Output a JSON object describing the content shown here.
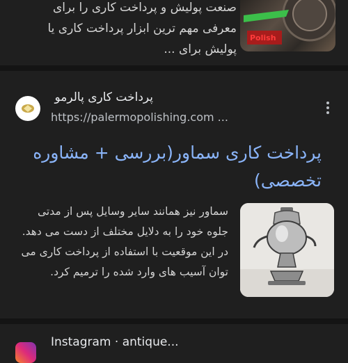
{
  "result1": {
    "snippet_lines": [
      "صنعت پولیش و پرداخت کاری را برای",
      "معرفی مهم ترین ابزار پرداخت کاری یا",
      "پولیش برای ..."
    ],
    "thumb_text": "Polish"
  },
  "result2": {
    "site_name": "پرداخت کاری پالرمو",
    "url": "https://palermopolishing.com ...",
    "title": "پرداخت کاری سماور(بررسی + مشاوره تخصصی)",
    "body": "سماور نیز همانند سایر وسایل پس از مدتی جلوه خود را به دلایل مختلف از دست می دهد. در این موقعیت با استفاده از پرداخت کاری می توان آسیب های وارد شده را ترمیم کرد.",
    "favicon_icon": "palermo-logo-icon",
    "menu_icon": "more-vert-icon"
  },
  "result3": {
    "site_name": "Instagram · antique...",
    "favicon_icon": "instagram-icon"
  },
  "colors": {
    "background": "#1f1f1f",
    "separator": "#141414",
    "link": "#8ab4f8",
    "text": "#d4d4d4"
  }
}
